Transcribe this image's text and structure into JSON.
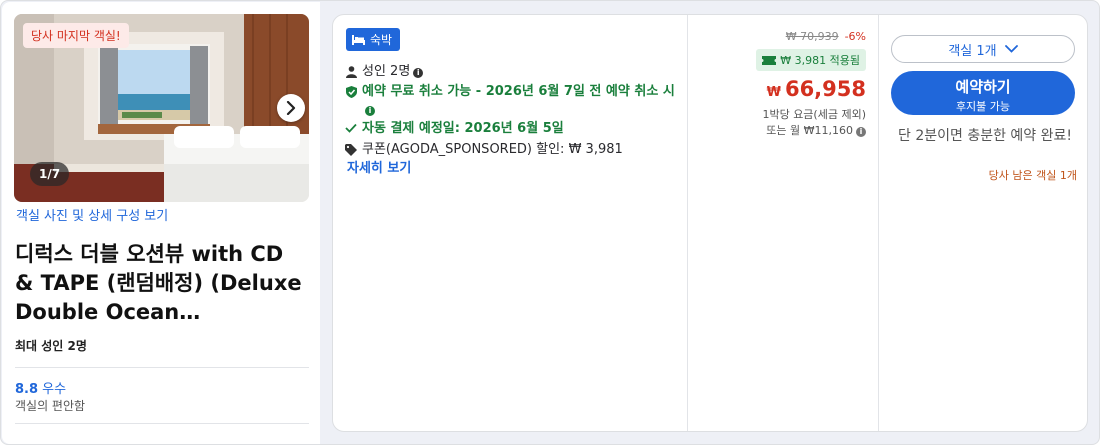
{
  "left": {
    "photo": {
      "tag": "당사 마지막 객실!",
      "counter": "1/7"
    },
    "photo_link": "객실 사진 및 상세 구성 보기",
    "title": "디럭스 더블 오션뷰 with CD & TAPE (랜덤배정) (Deluxe Double Ocean…",
    "max_occupancy": "최대 성인 2명",
    "rating_score": "8.8",
    "rating_word": "우수",
    "rating_sub": "객실의 편안함"
  },
  "features": {
    "badge": "숙박",
    "guests": "성인 2명",
    "cancel": "예약 무료 취소 가능 - 2026년 6월 7일 전 예약 취소 시",
    "auto_pay": "자동 결제 예정일: 2026년 6월 5일",
    "coupon": "쿠폰(AGODA_SPONSORED) 할인: ₩ 3,981",
    "detail_link": "자세히 보기"
  },
  "price": {
    "original": "₩ 70,939",
    "discount_pct": "-6%",
    "coupon_applied": "₩ 3,981 적용됨",
    "currency": "₩",
    "amount": "66,958",
    "note_1": "1박당 요금(세금 제외)",
    "note_2": "또는 월 ₩11,160"
  },
  "booking": {
    "room_select": "객실 1개",
    "book_label": "예약하기",
    "book_sub": "후지불 가능",
    "urgency": "단 2분이면 충분한 예약 완료!",
    "rooms_left": "당사 남은 객실 1개"
  },
  "colors": {
    "accent_blue": "#2067da",
    "price_red": "#d3301f",
    "green": "#1a7f3c"
  }
}
